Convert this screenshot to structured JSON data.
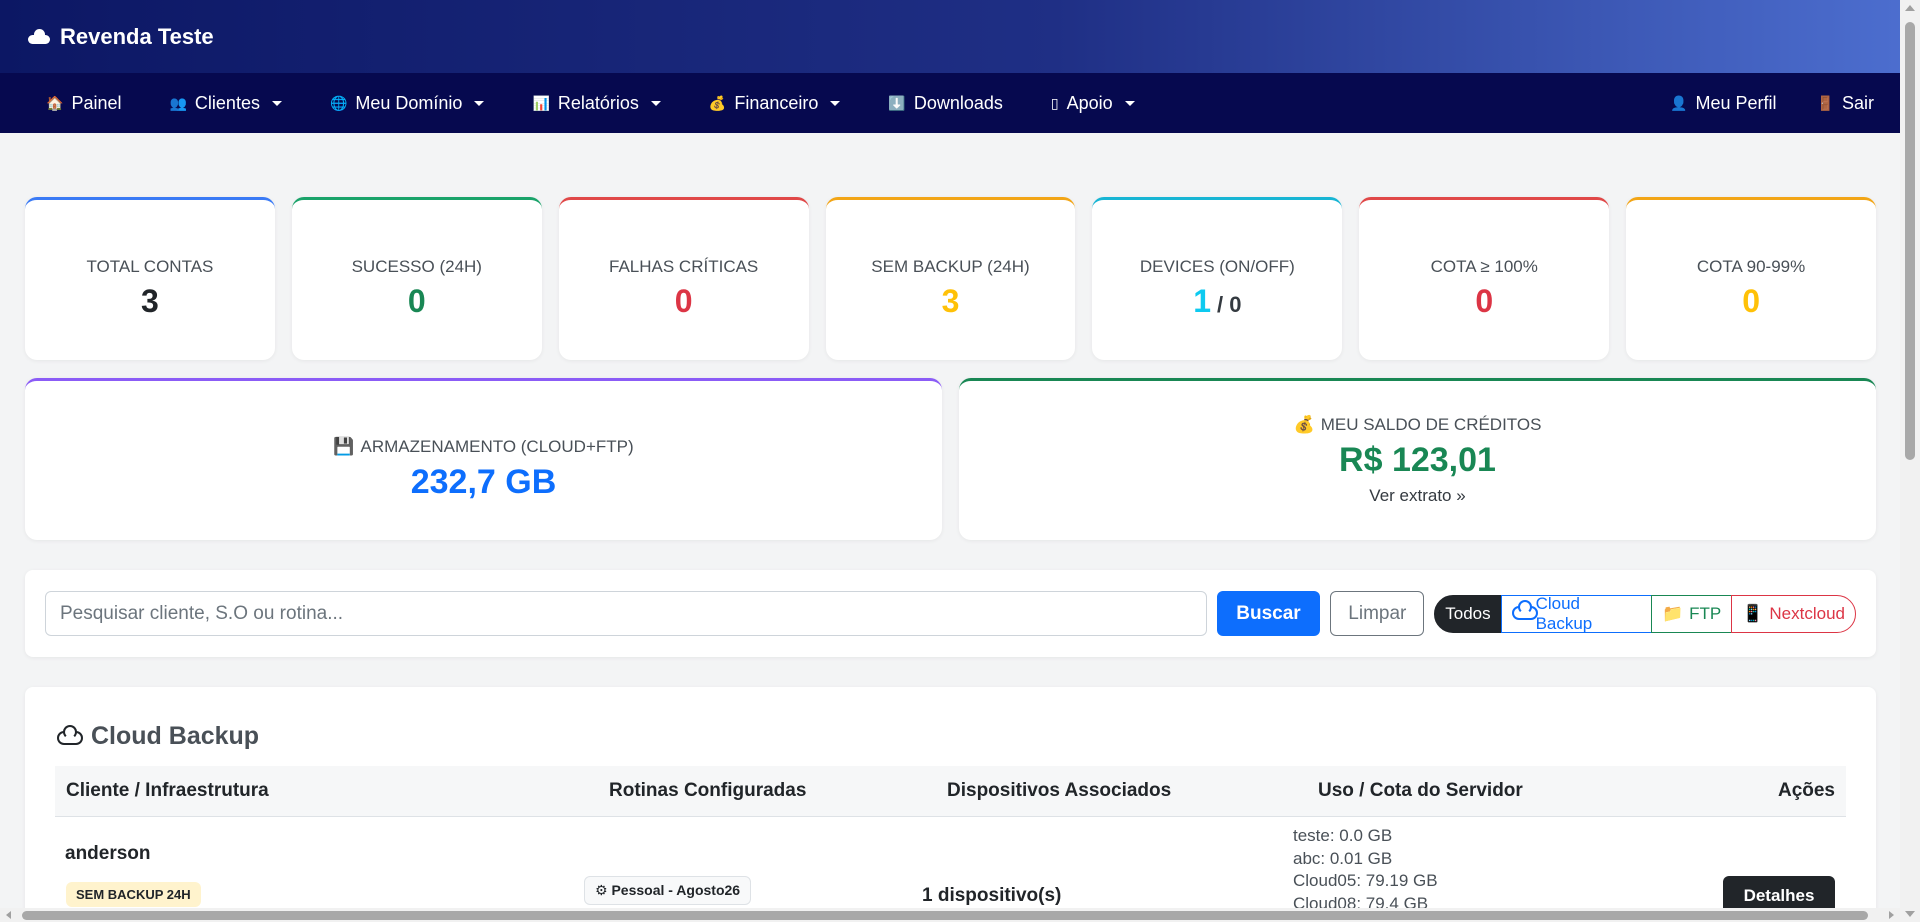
{
  "brand": {
    "title": "Revenda Teste",
    "icon": "cloud-icon"
  },
  "nav": {
    "left": [
      {
        "label": "Painel",
        "icon": "🏠",
        "dropdown": false
      },
      {
        "label": "Clientes",
        "icon": "👥",
        "dropdown": true
      },
      {
        "label": "Meu Domínio",
        "icon": "🌐",
        "dropdown": true
      },
      {
        "label": "Relatórios",
        "icon": "📊",
        "dropdown": true
      },
      {
        "label": "Financeiro",
        "icon": "💰",
        "dropdown": true
      },
      {
        "label": "Downloads",
        "icon": "⬇️",
        "dropdown": false
      },
      {
        "label": "Apoio",
        "icon": "▯",
        "dropdown": true
      }
    ],
    "right": [
      {
        "label": "Meu Perfil",
        "icon": "👤"
      },
      {
        "label": "Sair",
        "icon": "🚪"
      }
    ]
  },
  "stats": [
    {
      "label": "TOTAL CONTAS",
      "value": "3",
      "color": "#212529",
      "border": "#3a7af5"
    },
    {
      "label": "SUCESSO (24H)",
      "value": "0",
      "color": "#198754",
      "border": "#1aa36a"
    },
    {
      "label": "FALHAS CRÍTICAS",
      "value": "0",
      "color": "#dc3545",
      "border": "#e04848"
    },
    {
      "label": "SEM BACKUP (24H)",
      "value": "3",
      "color": "#ffc107",
      "border": "#f2a516"
    },
    {
      "label": "DEVICES (ON/OFF)",
      "value": "1",
      "sub": "/ 0",
      "color": "#0dcaf0",
      "border": "#17b5d4"
    },
    {
      "label": "COTA ≥ 100%",
      "value": "0",
      "color": "#dc3545",
      "border": "#e04848"
    },
    {
      "label": "COTA 90-99%",
      "value": "0",
      "color": "#ffc107",
      "border": "#f2a516"
    }
  ],
  "storage": {
    "icon": "💾",
    "label": "ARMAZENAMENTO (CLOUD+FTP)",
    "value": "232,7 GB",
    "color": "#0d6efd",
    "border": "#8b5cf6"
  },
  "credits": {
    "icon": "💰",
    "label": "MEU SALDO DE CRÉDITOS",
    "value": "R$ 123,01",
    "link": "Ver extrato »",
    "color": "#198754",
    "border": "#198754"
  },
  "search": {
    "placeholder": "Pesquisar cliente, S.O ou rotina...",
    "value": "",
    "buscar": "Buscar",
    "limpar": "Limpar",
    "filters": [
      {
        "label": "Todos",
        "icon": "",
        "active": true
      },
      {
        "label": "Cloud Backup",
        "icon": "☁"
      },
      {
        "label": "FTP",
        "icon": "📁"
      },
      {
        "label": "Nextcloud",
        "icon": "📱"
      }
    ]
  },
  "table": {
    "title": "Cloud Backup",
    "columns": [
      "Cliente / Infraestrutura",
      "Rotinas Configuradas",
      "Dispositivos Associados",
      "Uso / Cota do Servidor",
      "Ações"
    ],
    "rows": [
      {
        "client": "anderson",
        "badge": "SEM BACKUP 24H",
        "rotina": "Pessoal - Agosto26",
        "rotina_icon": "⚙",
        "devices": "1 dispositivo(s)",
        "uso": [
          "teste: 0.0 GB",
          "abc: 0.01 GB",
          "Cloud05: 79.19 GB",
          "Cloud08: 79.4 GB"
        ],
        "action": "Detalhes"
      }
    ]
  }
}
